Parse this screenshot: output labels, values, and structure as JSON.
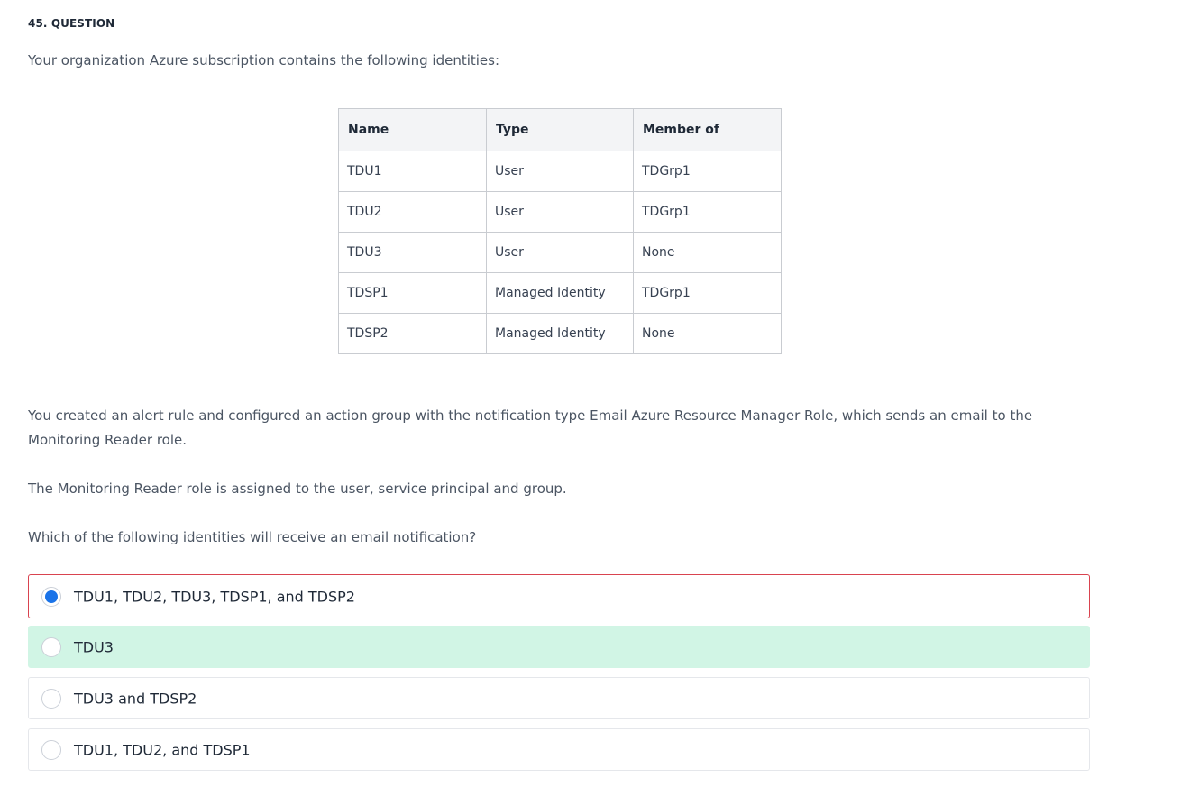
{
  "question": {
    "number_label": "45. QUESTION",
    "intro": "Your organization Azure subscription contains the following identities:",
    "table": {
      "headers": [
        "Name",
        "Type",
        "Member of"
      ],
      "rows": [
        [
          "TDU1",
          "User",
          "TDGrp1"
        ],
        [
          "TDU2",
          "User",
          "TDGrp1"
        ],
        [
          "TDU3",
          "User",
          "None"
        ],
        [
          "TDSP1",
          "Managed Identity",
          "TDGrp1"
        ],
        [
          "TDSP2",
          "Managed Identity",
          "None"
        ]
      ]
    },
    "paragraph1": "You created an alert rule and configured an action group with the notification type Email Azure Resource Manager Role, which sends an email to the Monitoring Reader role.",
    "paragraph2": "The Monitoring Reader role is assigned to the user, service principal and group.",
    "prompt": "Which of the following identities will receive an email notification?",
    "options": [
      {
        "label": "TDU1, TDU2, TDU3, TDSP1, and TDSP2",
        "selected": true,
        "state": "incorrect"
      },
      {
        "label": "TDU3",
        "selected": false,
        "state": "correct"
      },
      {
        "label": "TDU3 and TDSP2",
        "selected": false,
        "state": "neutral"
      },
      {
        "label": "TDU1, TDU2, and TDSP1",
        "selected": false,
        "state": "neutral"
      }
    ]
  },
  "colors": {
    "selected_radio": "#1a73e8",
    "incorrect_border": "#d9434f",
    "correct_background": "#d1f5e5",
    "table_header_background": "#f3f4f6"
  }
}
